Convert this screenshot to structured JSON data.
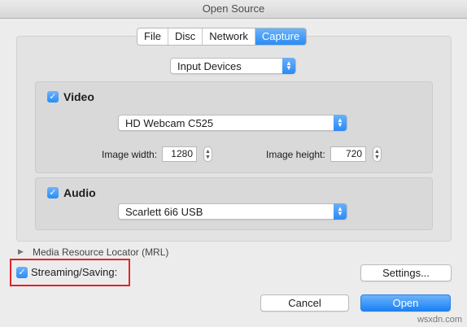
{
  "window": {
    "title": "Open Source"
  },
  "tabs": [
    {
      "label": "File",
      "active": false
    },
    {
      "label": "Disc",
      "active": false
    },
    {
      "label": "Network",
      "active": false
    },
    {
      "label": "Capture",
      "active": true
    }
  ],
  "capture_mode": {
    "selected": "Input Devices"
  },
  "video": {
    "checkbox_label": "Video",
    "checked": true,
    "device": "HD Webcam C525",
    "width_label": "Image width:",
    "width_value": "1280",
    "height_label": "Image height:",
    "height_value": "720"
  },
  "audio": {
    "checkbox_label": "Audio",
    "checked": true,
    "device": "Scarlett 6i6 USB"
  },
  "mrl": {
    "label": "Media Resource Locator (MRL)"
  },
  "streaming": {
    "label": "Streaming/Saving:",
    "checked": true
  },
  "buttons": {
    "settings": "Settings...",
    "cancel": "Cancel",
    "open": "Open"
  },
  "watermark": "wsxdn.com",
  "colors": {
    "accent": "#2a8cf6",
    "highlight": "#e2242a"
  }
}
